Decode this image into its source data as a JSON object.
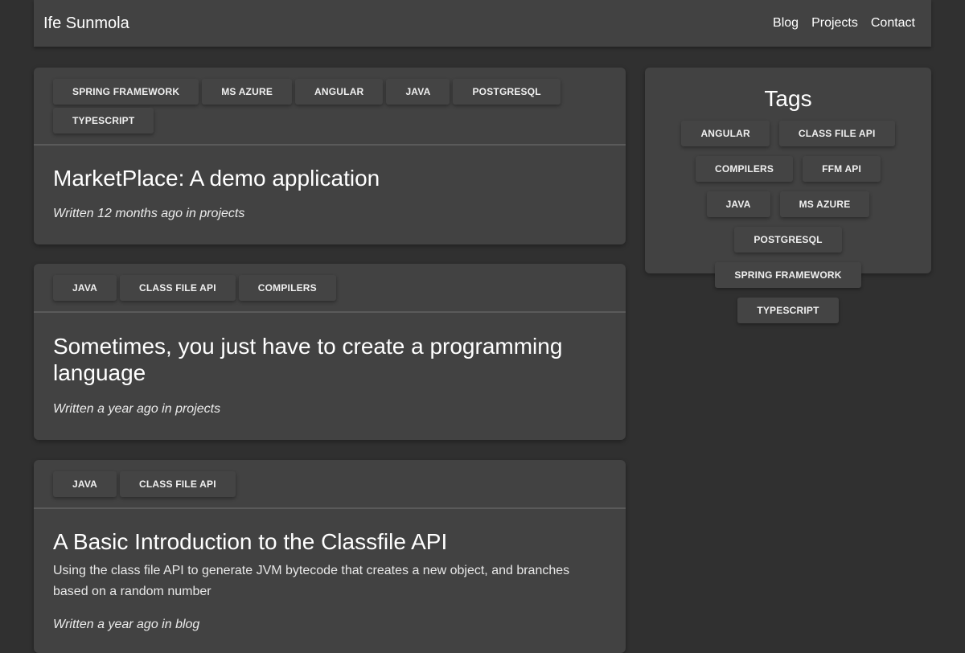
{
  "header": {
    "brand": "Ife Sunmola",
    "nav": [
      "Blog",
      "Projects",
      "Contact"
    ]
  },
  "posts": [
    {
      "tags": [
        "SPRING FRAMEWORK",
        "MS AZURE",
        "ANGULAR",
        "JAVA",
        "POSTGRESQL",
        "TYPESCRIPT"
      ],
      "title": "MarketPlace: A demo application",
      "description": "",
      "meta": "Written 12 months ago in projects"
    },
    {
      "tags": [
        "JAVA",
        "CLASS FILE API",
        "COMPILERS"
      ],
      "title": "Sometimes, you just have to create a programming language",
      "description": "",
      "meta": "Written a year ago in projects"
    },
    {
      "tags": [
        "JAVA",
        "CLASS FILE API"
      ],
      "title": "A Basic Introduction to the Classfile API",
      "description": "Using the class file API to generate JVM bytecode that creates a new object, and branches based on a random number",
      "meta": "Written a year ago in blog"
    }
  ],
  "sidebar": {
    "title": "Tags",
    "tags": [
      "ANGULAR",
      "CLASS FILE API",
      "COMPILERS",
      "FFM API",
      "JAVA",
      "MS AZURE",
      "POSTGRESQL",
      "SPRING FRAMEWORK",
      "TYPESCRIPT"
    ]
  }
}
